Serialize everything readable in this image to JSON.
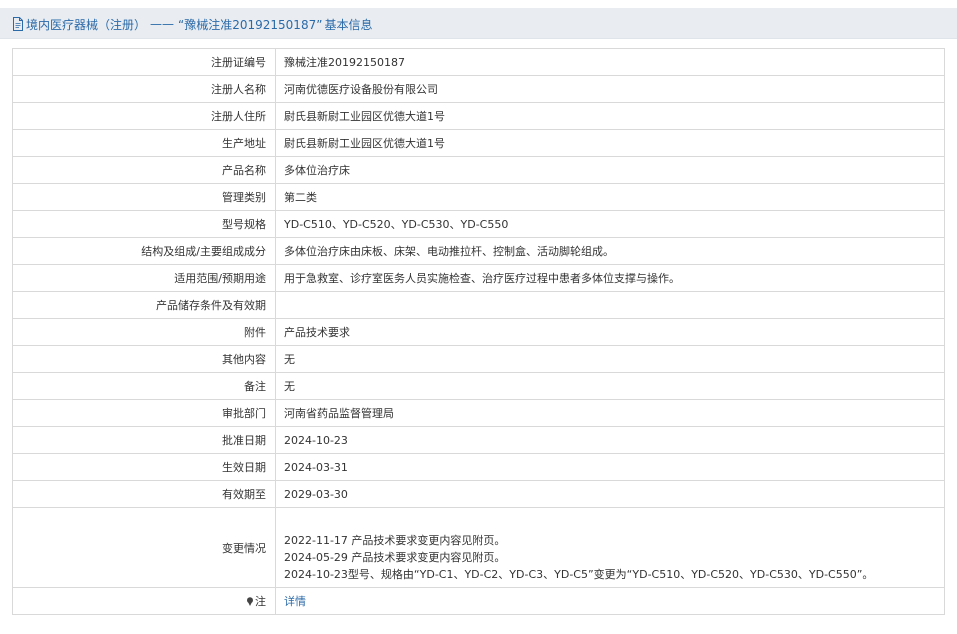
{
  "header": {
    "prefix": "境内医疗器械（注册）",
    "separator": "——",
    "reg_quoted": "“豫械注准20192150187”",
    "suffix": "基本信息",
    "accent_color": "#2b6aa8"
  },
  "fields": [
    {
      "label": "注册证编号",
      "value": "豫械注准20192150187"
    },
    {
      "label": "注册人名称",
      "value": "河南优德医疗设备股份有限公司"
    },
    {
      "label": "注册人住所",
      "value": "尉氏县新尉工业园区优德大道1号"
    },
    {
      "label": "生产地址",
      "value": "尉氏县新尉工业园区优德大道1号"
    },
    {
      "label": "产品名称",
      "value": "多体位治疗床"
    },
    {
      "label": "管理类别",
      "value": "第二类"
    },
    {
      "label": "型号规格",
      "value": "YD-C510、YD-C520、YD-C530、YD-C550"
    },
    {
      "label": "结构及组成/主要组成成分",
      "value": "多体位治疗床由床板、床架、电动推拉杆、控制盒、活动脚轮组成。"
    },
    {
      "label": "适用范围/预期用途",
      "value": "用于急救室、诊疗室医务人员实施检查、治疗医疗过程中患者多体位支撑与操作。"
    },
    {
      "label": "产品储存条件及有效期",
      "value": ""
    },
    {
      "label": "附件",
      "value": "产品技术要求"
    },
    {
      "label": "其他内容",
      "value": "无"
    },
    {
      "label": "备注",
      "value": "无"
    },
    {
      "label": "审批部门",
      "value": "河南省药品监督管理局"
    },
    {
      "label": "批准日期",
      "value": "2024-10-23"
    },
    {
      "label": "生效日期",
      "value": "2024-03-31"
    },
    {
      "label": "有效期至",
      "value": "2029-03-30"
    }
  ],
  "changes": {
    "label": "变更情况",
    "lines": [
      "2022-11-17 产品技术要求变更内容见附页。",
      "2024-05-29 产品技术要求变更内容见附页。",
      "2024-10-23型号、规格由“YD-C1、YD-C2、YD-C3、YD-C5”变更为“YD-C510、YD-C520、YD-C530、YD-C550”。"
    ]
  },
  "note": {
    "icon": "pin-icon",
    "label": "注",
    "link_text": "详情"
  }
}
